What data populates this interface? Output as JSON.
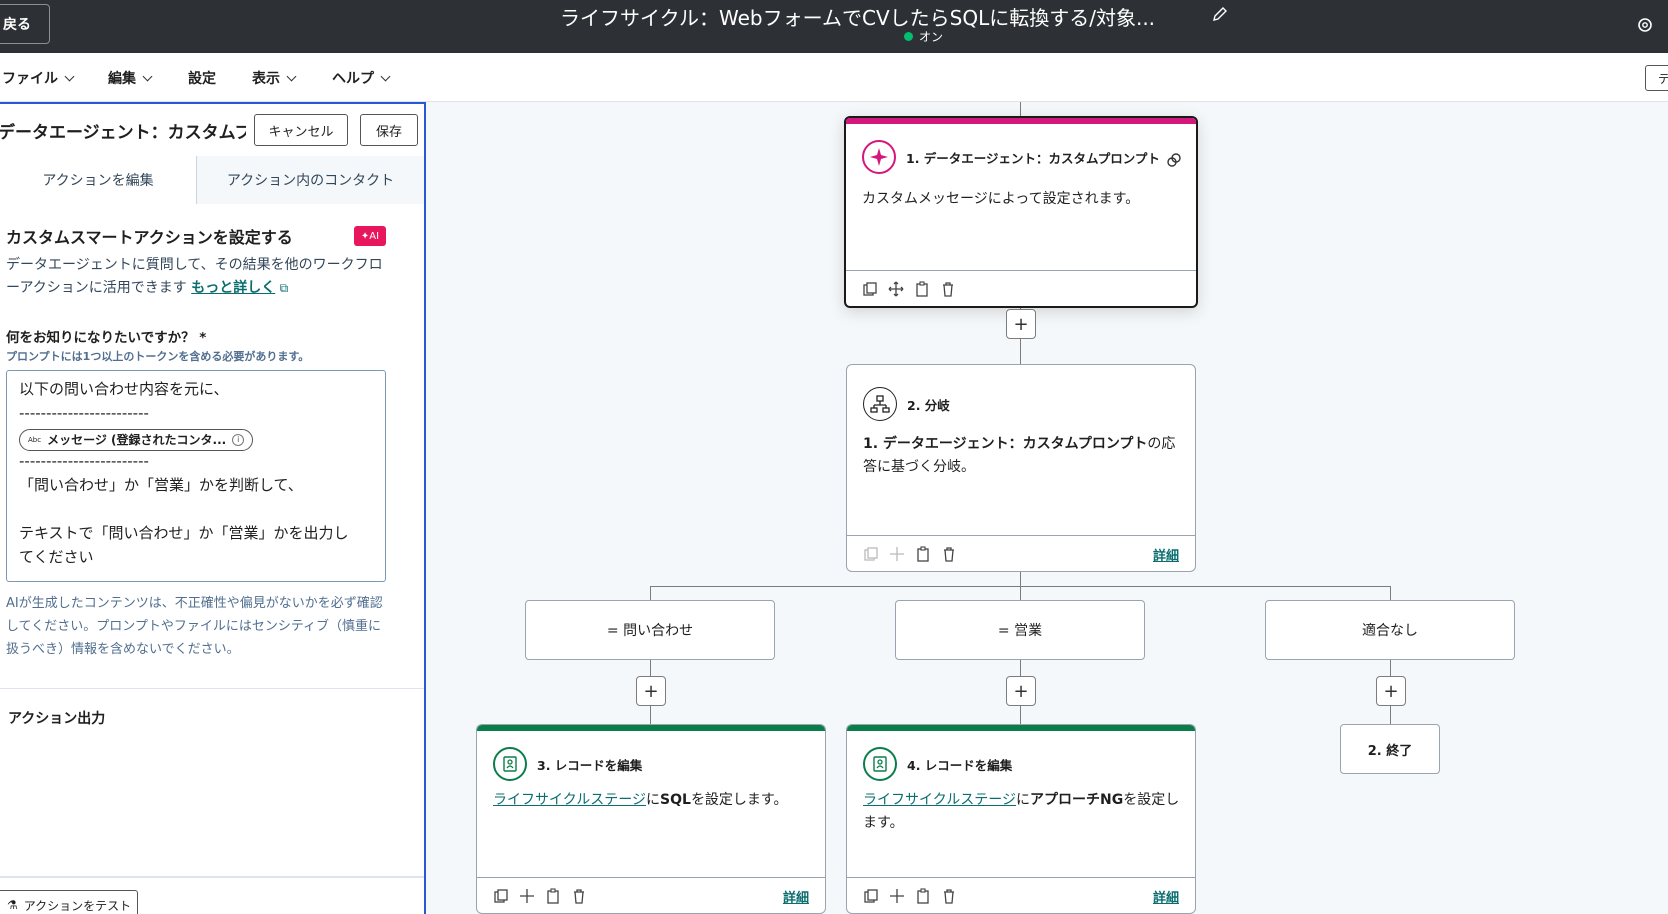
{
  "topbar": {
    "back_label": "戻る",
    "title": "ライフサイクル：WebフォームでCVしたらSQLに転換する/対象...",
    "status_label": "オン",
    "status_color": "#00bf6f"
  },
  "menu": {
    "items": [
      {
        "label": "ファイル"
      },
      {
        "label": "編集"
      },
      {
        "label": "設定"
      },
      {
        "label": "表示"
      },
      {
        "label": "ヘルプ"
      }
    ],
    "right_button": "テ"
  },
  "panel": {
    "title": "データエージェント：カスタムプ...",
    "cancel_label": "キャンセル",
    "save_label": "保存",
    "tabs": [
      "アクションを編集",
      "アクション内のコンタクト"
    ],
    "section_title": "カスタムスマートアクションを設定する",
    "ai_badge": "AI",
    "description": "データエージェントに質問して、その結果を他のワークフローアクションに活用できます",
    "learn_more": "もっと詳しく",
    "field_label": "何をお知りになりたいですか？ *",
    "field_help": "プロンプトには1つ以上のトークンを含める必要があります。",
    "prompt_lines": {
      "l1": "以下の問い合わせ内容を元に、",
      "sep1": "------------------------",
      "token_abc": "Abc",
      "token_label": "メッセージ (登録されたコンタ...",
      "sep2": "------------------------",
      "l3": "「問い合わせ」か「営業」かを判断して、",
      "l4": "テキストで「問い合わせ」か「営業」かを出力し",
      "l5": "てください"
    },
    "disclaimer": "AIが生成したコンテンツは、不正確性や偏見がないかを必ず確認してください。プロンプトやファイルにはセンシティブ（慎重に扱うべき）情報を含めないでください。",
    "output_title": "アクション出力",
    "test_label": "アクションをテスト"
  },
  "workflow": {
    "card1": {
      "title": "1. データエージェント：カスタムプロンプト",
      "body": "カスタムメッセージによって設定されます。",
      "accent": "#d4177d"
    },
    "card2": {
      "title": "2. 分岐",
      "body_bold": "1. データエージェント：カスタムプロンプト",
      "body_mid": "の応答",
      "body_end": "に基づく分岐。",
      "detail": "詳細"
    },
    "branches": [
      {
        "label": "= 問い合わせ"
      },
      {
        "label": "= 営業"
      },
      {
        "label": "適合なし"
      }
    ],
    "card3": {
      "title": "3. レコードを編集",
      "link": "ライフサイクルステージ",
      "mid": "に",
      "value": "SQL",
      "end": "を設定します。",
      "detail": "詳細",
      "accent": "#0a7e4a"
    },
    "card4": {
      "title": "4. レコードを編集",
      "link": "ライフサイクルステージ",
      "mid": "に",
      "value": "アプローチNG",
      "end": "を設定します。",
      "detail": "詳細",
      "accent": "#0a7e4a"
    },
    "end_label": "2. 終了",
    "plus": "+"
  }
}
